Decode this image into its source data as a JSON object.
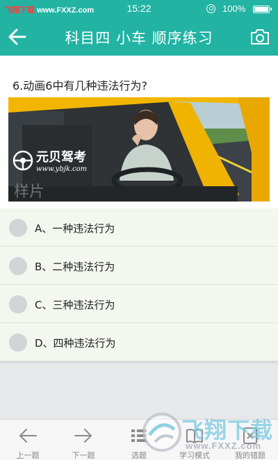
{
  "status_bar": {
    "carrier_text": "飞翔下载",
    "carrier_url": "www.FXXZ.com",
    "time": "15:22",
    "battery_percent": "100%"
  },
  "header": {
    "title": "科目四 小车 顺序练习"
  },
  "question": {
    "text": "6.动画6中有几种违法行为?"
  },
  "video": {
    "brand": "元贝驾考",
    "url": "www.ybjk.com",
    "sample_label": "样片"
  },
  "options": [
    {
      "label": "A、一种违法行为"
    },
    {
      "label": "B、二种违法行为"
    },
    {
      "label": "C、三种违法行为"
    },
    {
      "label": "D、四种违法行为"
    }
  ],
  "bottom_nav": [
    {
      "label": "上一题",
      "icon": "arrow-left-icon"
    },
    {
      "label": "下一题",
      "icon": "arrow-right-icon"
    },
    {
      "label": "选题",
      "icon": "grid-icon"
    },
    {
      "label": "学习模式",
      "icon": "book-icon"
    },
    {
      "label": "我的错题",
      "icon": "error-list-icon"
    }
  ],
  "watermark": {
    "text": "飞翔下载",
    "url": "www.FXXZ.com"
  },
  "colors": {
    "primary": "#22b3a3",
    "options_bg": "#f3f7ef",
    "page_bg": "#e6e8ea"
  }
}
